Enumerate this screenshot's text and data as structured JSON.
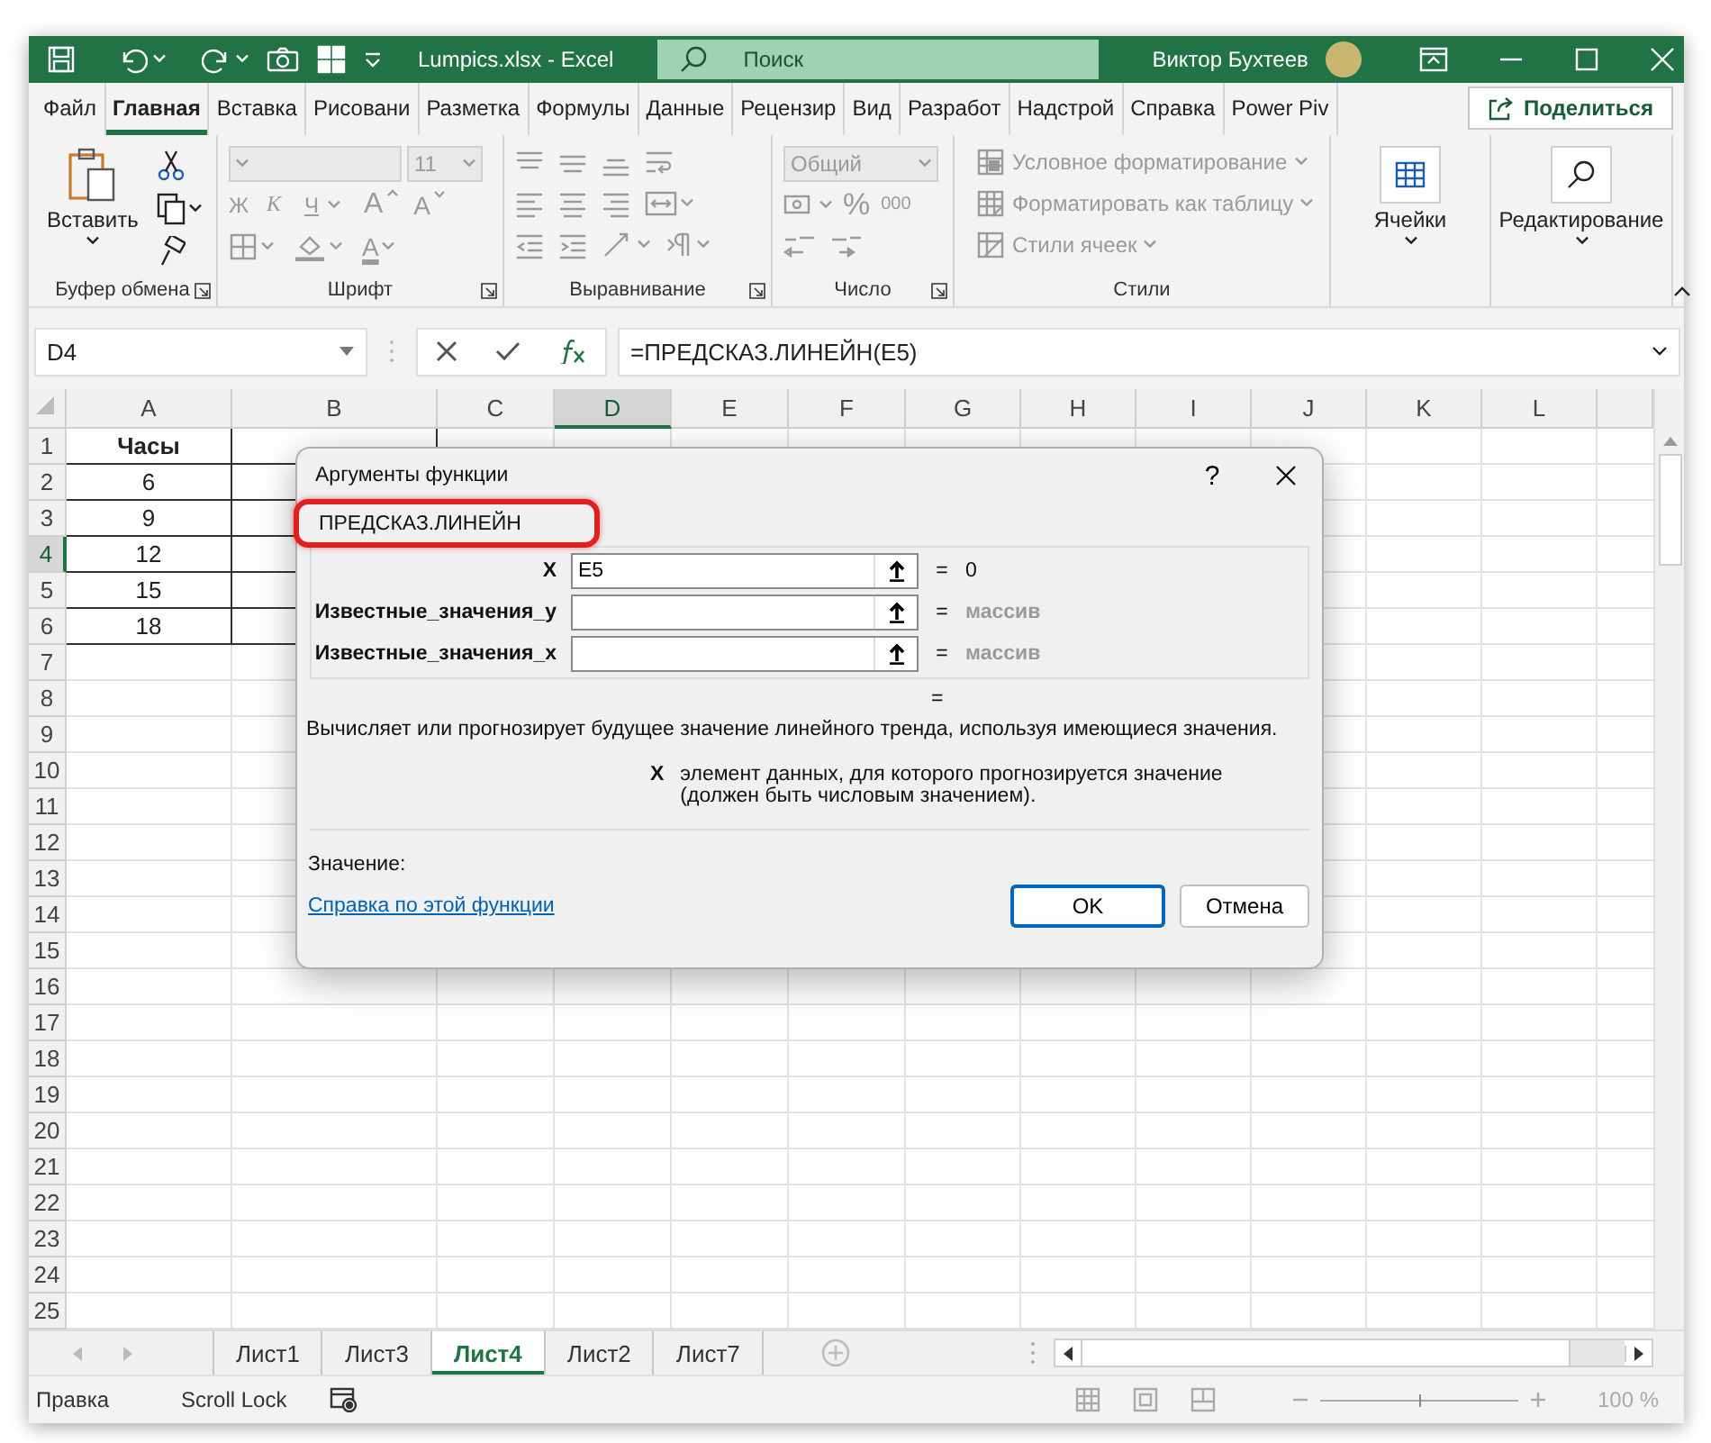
{
  "title_bar": {
    "file_title": "Lumpics.xlsx  -  Excel",
    "search": {
      "placeholder": "Поиск"
    },
    "user_name": "Виктор Бухтеев"
  },
  "ribbon_tabs": [
    {
      "label": "Файл",
      "selected": false
    },
    {
      "label": "Главная",
      "selected": true
    },
    {
      "label": "Вставка",
      "selected": false
    },
    {
      "label": "Рисовани",
      "selected": false
    },
    {
      "label": "Разметка",
      "selected": false
    },
    {
      "label": "Формулы",
      "selected": false
    },
    {
      "label": "Данные",
      "selected": false
    },
    {
      "label": "Рецензир",
      "selected": false
    },
    {
      "label": "Вид",
      "selected": false
    },
    {
      "label": "Разработ",
      "selected": false
    },
    {
      "label": "Надстрой",
      "selected": false
    },
    {
      "label": "Справка",
      "selected": false
    },
    {
      "label": "Power Piv",
      "selected": false
    }
  ],
  "share_button": {
    "label": "Поделиться"
  },
  "ribbon": {
    "clipboard": {
      "paste_label": "Вставить",
      "group_label": "Буфер обмена",
      "disabled": false
    },
    "font": {
      "size": "11",
      "buttons": [
        {
          "kind": "bold",
          "label": "Ж"
        },
        {
          "kind": "italic",
          "label": "К"
        },
        {
          "kind": "underline",
          "label": "Ч"
        },
        {
          "kind": "grow",
          "label": "A"
        },
        {
          "kind": "shrink",
          "label": "A"
        }
      ],
      "font_color_label": "A",
      "group_label": "Шрифт",
      "disabled": true
    },
    "alignment": {
      "group_label": "Выравнивание",
      "disabled": true
    },
    "number": {
      "format": "Общий",
      "percent_label": "%",
      "thousands_label": "000",
      "group_label": "Число",
      "disabled": true
    },
    "styles": {
      "items": [
        {
          "label": "Условное форматирование"
        },
        {
          "label": "Форматировать как таблицу"
        },
        {
          "label": "Стили ячеек"
        }
      ],
      "group_label": "Стили",
      "disabled": true
    },
    "cells": {
      "label": "Ячейки",
      "disabled": false
    },
    "editing": {
      "label": "Редактирование",
      "disabled": false
    }
  },
  "formula_bar": {
    "name_box": "D4",
    "formula": "=ПРЕДСКАЗ.ЛИНЕЙН(E5)"
  },
  "sheet": {
    "columns": [
      {
        "label": "A",
        "selected": false
      },
      {
        "label": "B",
        "selected": false
      },
      {
        "label": "C",
        "selected": false
      },
      {
        "label": "D",
        "selected": true
      },
      {
        "label": "E",
        "selected": false
      },
      {
        "label": "F",
        "selected": false
      },
      {
        "label": "G",
        "selected": false
      },
      {
        "label": "H",
        "selected": false
      },
      {
        "label": "I",
        "selected": false
      },
      {
        "label": "J",
        "selected": false
      },
      {
        "label": "K",
        "selected": false
      },
      {
        "label": "L",
        "selected": false
      }
    ],
    "rows": [
      {
        "header": "1",
        "selected": false,
        "bold": true,
        "cells": [
          "Часы"
        ]
      },
      {
        "header": "2",
        "selected": false,
        "bold": false,
        "cells": [
          "6"
        ]
      },
      {
        "header": "3",
        "selected": false,
        "bold": false,
        "cells": [
          "9"
        ]
      },
      {
        "header": "4",
        "selected": true,
        "bold": false,
        "cells": [
          "12"
        ]
      },
      {
        "header": "5",
        "selected": false,
        "bold": false,
        "cells": [
          "15"
        ]
      },
      {
        "header": "6",
        "selected": false,
        "bold": false,
        "cells": [
          "18"
        ]
      },
      {
        "header": "7",
        "selected": false
      },
      {
        "header": "8",
        "selected": false
      },
      {
        "header": "9",
        "selected": false
      },
      {
        "header": "10",
        "selected": false
      },
      {
        "header": "11",
        "selected": false
      },
      {
        "header": "12",
        "selected": false
      },
      {
        "header": "13",
        "selected": false
      },
      {
        "header": "14",
        "selected": false
      },
      {
        "header": "15",
        "selected": false
      },
      {
        "header": "16",
        "selected": false
      },
      {
        "header": "17",
        "selected": false
      },
      {
        "header": "18",
        "selected": false
      },
      {
        "header": "19",
        "selected": false
      },
      {
        "header": "20",
        "selected": false
      },
      {
        "header": "21",
        "selected": false
      },
      {
        "header": "22",
        "selected": false
      },
      {
        "header": "23",
        "selected": false
      },
      {
        "header": "24",
        "selected": false
      },
      {
        "header": "25",
        "selected": false
      }
    ]
  },
  "sheet_tabs": [
    {
      "label": "Лист1",
      "selected": false
    },
    {
      "label": "Лист3",
      "selected": false
    },
    {
      "label": "Лист4",
      "selected": true
    },
    {
      "label": "Лист2",
      "selected": false
    },
    {
      "label": "Лист7",
      "selected": false
    }
  ],
  "status_bar": {
    "mode": "Правка",
    "scroll_lock": "Scroll Lock",
    "zoom": "100 %",
    "zoom_slider": {
      "level": 0.5
    }
  },
  "dialog": {
    "title": "Аргументы функции",
    "help": "?",
    "function_name": "ПРЕДСКАЗ.ЛИНЕЙН",
    "highlighted": true,
    "arguments": [
      {
        "label": "X",
        "value": "E5",
        "equals": "=",
        "result": "0",
        "result_muted": false
      },
      {
        "label": "Известные_значения_y",
        "equals": "=",
        "result": "массив",
        "result_muted": true
      },
      {
        "label": "Известные_значения_x",
        "equals": "=",
        "result": "массив",
        "result_muted": true
      }
    ],
    "formula_result": "=",
    "description": "Вычисляет или прогнозирует будущее значение линейного тренда, используя имеющиеся значения.",
    "argument_help": {
      "name": "X",
      "text": "элемент данных, для которого прогнозируется значение\n(должен быть числовым значением)."
    },
    "value_label": "Значение:",
    "help_link": "Справка по этой функции",
    "buttons": [
      {
        "label": "OK",
        "default": true
      },
      {
        "label": "Отмена",
        "default": false
      }
    ]
  }
}
